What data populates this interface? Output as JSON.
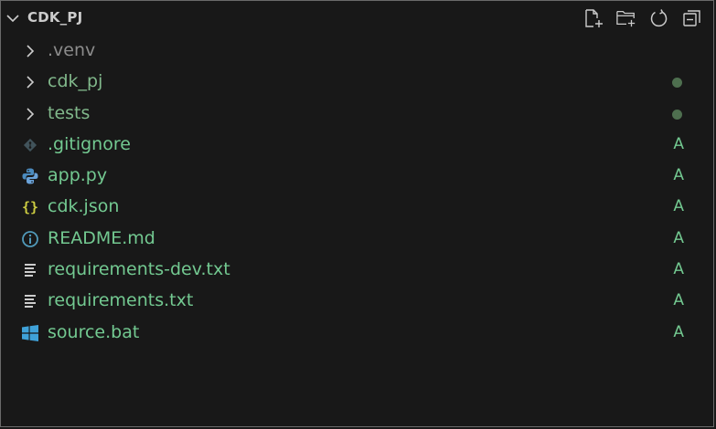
{
  "explorer": {
    "title": "CDK_PJ",
    "toolbar": [
      {
        "name": "new-file-button",
        "icon": "new-file-icon"
      },
      {
        "name": "new-folder-button",
        "icon": "new-folder-icon"
      },
      {
        "name": "refresh-button",
        "icon": "refresh-icon"
      },
      {
        "name": "collapse-all-button",
        "icon": "collapse-all-icon"
      }
    ],
    "items": [
      {
        "label": ".venv",
        "type": "folder",
        "color": "#8c8c8c",
        "status": ""
      },
      {
        "label": "cdk_pj",
        "type": "folder",
        "color": "#81b88b",
        "status": "dot"
      },
      {
        "label": "tests",
        "type": "folder",
        "color": "#81b88b",
        "status": "dot"
      },
      {
        "label": ".gitignore",
        "type": "file",
        "icon": "git-icon",
        "color": "#73c991",
        "status": "A"
      },
      {
        "label": "app.py",
        "type": "file",
        "icon": "python-icon",
        "color": "#73c991",
        "status": "A"
      },
      {
        "label": "cdk.json",
        "type": "file",
        "icon": "json-icon",
        "color": "#73c991",
        "status": "A"
      },
      {
        "label": "README.md",
        "type": "file",
        "icon": "info-icon",
        "color": "#73c991",
        "status": "A"
      },
      {
        "label": "requirements-dev.txt",
        "type": "file",
        "icon": "text-file-icon",
        "color": "#73c991",
        "status": "A"
      },
      {
        "label": "requirements.txt",
        "type": "file",
        "icon": "text-file-icon",
        "color": "#73c991",
        "status": "A"
      },
      {
        "label": "source.bat",
        "type": "file",
        "icon": "windows-icon",
        "color": "#73c991",
        "status": "A"
      }
    ]
  },
  "colors": {
    "background": "#181818",
    "added": "#73c991",
    "ignored": "#8c8c8c",
    "dot": "#4e6f4f"
  }
}
